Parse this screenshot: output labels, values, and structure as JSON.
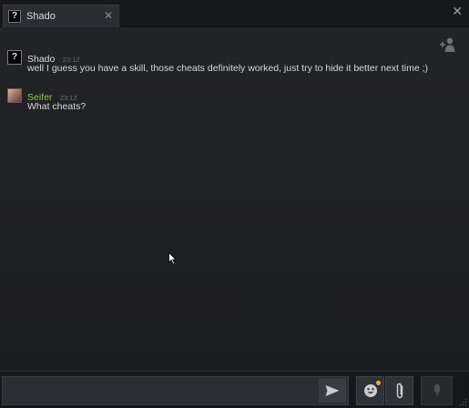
{
  "tab": {
    "avatar_glyph": "?",
    "name": "Shado",
    "close_glyph": "✕"
  },
  "window": {
    "close_glyph": "✕"
  },
  "messages": [
    {
      "avatar_glyph": "?",
      "sender": "Shado",
      "time": "23:12",
      "text": "well I guess you have a skill, those cheats definitely worked, just try to hide it better next time ;)"
    },
    {
      "sender": "Seifer",
      "time": "23:12",
      "text": "What cheats?"
    }
  ],
  "input": {
    "value": "",
    "placeholder": ""
  },
  "icons": {
    "add_friend": "add-friend-icon",
    "send": "send-icon",
    "emoji": "emoji-icon",
    "attach": "paperclip-icon",
    "voice": "microphone-icon"
  },
  "colors": {
    "accent_green": "#8bc34a",
    "notification_dot": "#e8b130",
    "background": "#1e1f22"
  }
}
